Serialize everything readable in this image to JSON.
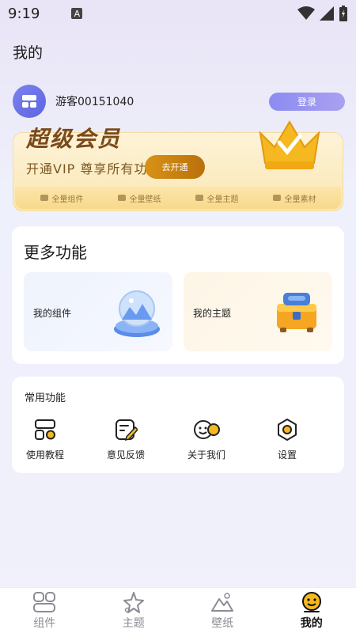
{
  "status": {
    "time": "9:19",
    "a_badge": "A"
  },
  "header": {
    "title": "我的"
  },
  "profile": {
    "username": "游客00151040",
    "login_label": "登录"
  },
  "vip": {
    "title": "超级会员",
    "subtitle": "开通VIP  尊享所有功",
    "button": "去开通",
    "perks": [
      "全量组件",
      "全量壁纸",
      "全量主题",
      "全量素材"
    ]
  },
  "more": {
    "title": "更多功能",
    "tiles": [
      {
        "label": "我的组件"
      },
      {
        "label": "我的主题"
      }
    ]
  },
  "common": {
    "title": "常用功能",
    "items": [
      {
        "label": "使用教程",
        "icon": "tutorial-icon"
      },
      {
        "label": "意见反馈",
        "icon": "feedback-icon"
      },
      {
        "label": "关于我们",
        "icon": "about-icon"
      },
      {
        "label": "设置",
        "icon": "settings-icon"
      }
    ]
  },
  "nav": {
    "items": [
      {
        "label": "组件"
      },
      {
        "label": "主题"
      },
      {
        "label": "壁纸"
      },
      {
        "label": "我的"
      }
    ],
    "active_color": "#111111",
    "inactive_color": "#8c8c96"
  },
  "colors": {
    "accent": "#7c82ee",
    "vip_gold": "#d99216"
  }
}
